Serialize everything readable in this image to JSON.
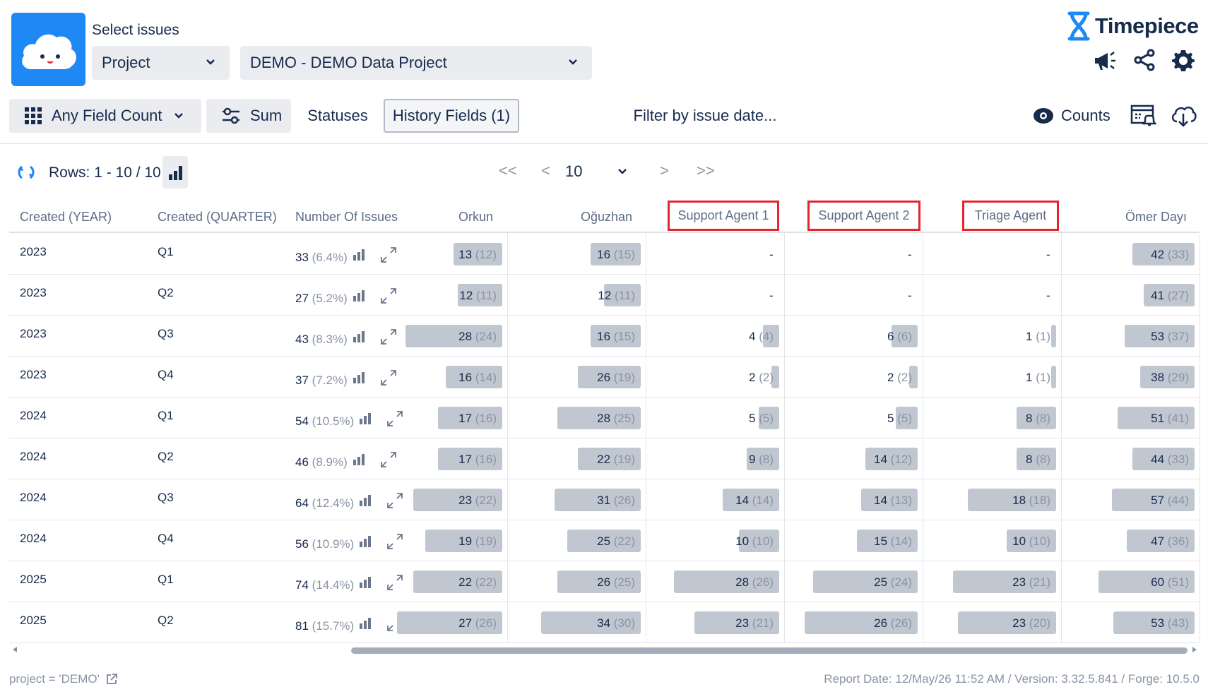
{
  "header": {
    "select_label": "Select issues",
    "project_dropdown": "Project",
    "project_value": "DEMO - DEMO Data Project",
    "brand": "Timepiece"
  },
  "toolbar": {
    "any_field_count": "Any Field Count",
    "sum": "Sum",
    "statuses": "Statuses",
    "history_fields": "History Fields (1)",
    "filter_by_date": "Filter by issue date...",
    "counts": "Counts"
  },
  "pagination": {
    "rows_label": "Rows: 1 - 10 / 10",
    "first": "<<",
    "prev": "<",
    "page_size": "10",
    "next": ">",
    "last": ">>"
  },
  "table": {
    "columns": [
      "Created (YEAR)",
      "Created (QUARTER)",
      "Number Of Issues",
      "Orkun",
      "Oğuzhan",
      "Support Agent 1",
      "Support Agent 2",
      "Triage Agent",
      "Ömer Dayı"
    ],
    "highlighted_columns": [
      "Support Agent 1",
      "Support Agent 2",
      "Triage Agent"
    ],
    "max_values": [
      28,
      34,
      28,
      26,
      23,
      60
    ],
    "rows": [
      {
        "year": "2023",
        "quarter": "Q1",
        "count": "33",
        "pct": "(6.4%)",
        "cells": [
          [
            "13",
            "(12)"
          ],
          [
            "16",
            "(15)"
          ],
          null,
          null,
          null,
          [
            "42",
            "(33)"
          ]
        ]
      },
      {
        "year": "2023",
        "quarter": "Q2",
        "count": "27",
        "pct": "(5.2%)",
        "cells": [
          [
            "12",
            "(11)"
          ],
          [
            "12",
            "(11)"
          ],
          null,
          null,
          null,
          [
            "41",
            "(27)"
          ]
        ]
      },
      {
        "year": "2023",
        "quarter": "Q3",
        "count": "43",
        "pct": "(8.3%)",
        "cells": [
          [
            "28",
            "(24)"
          ],
          [
            "16",
            "(15)"
          ],
          [
            "4",
            "(4)"
          ],
          [
            "6",
            "(6)"
          ],
          [
            "1",
            "(1)"
          ],
          [
            "53",
            "(37)"
          ]
        ]
      },
      {
        "year": "2023",
        "quarter": "Q4",
        "count": "37",
        "pct": "(7.2%)",
        "cells": [
          [
            "16",
            "(14)"
          ],
          [
            "26",
            "(19)"
          ],
          [
            "2",
            "(2)"
          ],
          [
            "2",
            "(2)"
          ],
          [
            "1",
            "(1)"
          ],
          [
            "38",
            "(29)"
          ]
        ]
      },
      {
        "year": "2024",
        "quarter": "Q1",
        "count": "54",
        "pct": "(10.5%)",
        "cells": [
          [
            "17",
            "(16)"
          ],
          [
            "28",
            "(25)"
          ],
          [
            "5",
            "(5)"
          ],
          [
            "5",
            "(5)"
          ],
          [
            "8",
            "(8)"
          ],
          [
            "51",
            "(41)"
          ]
        ]
      },
      {
        "year": "2024",
        "quarter": "Q2",
        "count": "46",
        "pct": "(8.9%)",
        "cells": [
          [
            "17",
            "(16)"
          ],
          [
            "22",
            "(19)"
          ],
          [
            "9",
            "(8)"
          ],
          [
            "14",
            "(12)"
          ],
          [
            "8",
            "(8)"
          ],
          [
            "44",
            "(33)"
          ]
        ]
      },
      {
        "year": "2024",
        "quarter": "Q3",
        "count": "64",
        "pct": "(12.4%)",
        "cells": [
          [
            "23",
            "(22)"
          ],
          [
            "31",
            "(26)"
          ],
          [
            "14",
            "(14)"
          ],
          [
            "14",
            "(13)"
          ],
          [
            "18",
            "(18)"
          ],
          [
            "57",
            "(44)"
          ]
        ]
      },
      {
        "year": "2024",
        "quarter": "Q4",
        "count": "56",
        "pct": "(10.9%)",
        "cells": [
          [
            "19",
            "(19)"
          ],
          [
            "25",
            "(22)"
          ],
          [
            "10",
            "(10)"
          ],
          [
            "15",
            "(14)"
          ],
          [
            "10",
            "(10)"
          ],
          [
            "47",
            "(36)"
          ]
        ]
      },
      {
        "year": "2025",
        "quarter": "Q1",
        "count": "74",
        "pct": "(14.4%)",
        "cells": [
          [
            "22",
            "(22)"
          ],
          [
            "26",
            "(25)"
          ],
          [
            "28",
            "(26)"
          ],
          [
            "25",
            "(24)"
          ],
          [
            "23",
            "(21)"
          ],
          [
            "60",
            "(51)"
          ]
        ]
      },
      {
        "year": "2025",
        "quarter": "Q2",
        "count": "81",
        "pct": "(15.7%)",
        "cells": [
          [
            "27",
            "(26)"
          ],
          [
            "34",
            "(30)"
          ],
          [
            "23",
            "(21)"
          ],
          [
            "26",
            "(26)"
          ],
          [
            "23",
            "(20)"
          ],
          [
            "53",
            "(43)"
          ]
        ]
      }
    ],
    "empty_value": "-"
  },
  "footer": {
    "query": "project = 'DEMO'",
    "report_info": "Report Date: 12/May/26 11:52 AM / Version: 3.32.5.841 / Forge: 10.5.0"
  },
  "colors": {
    "accent": "#1e88f5",
    "bar": "#c1c7d0",
    "highlight_border": "#e3262e"
  }
}
